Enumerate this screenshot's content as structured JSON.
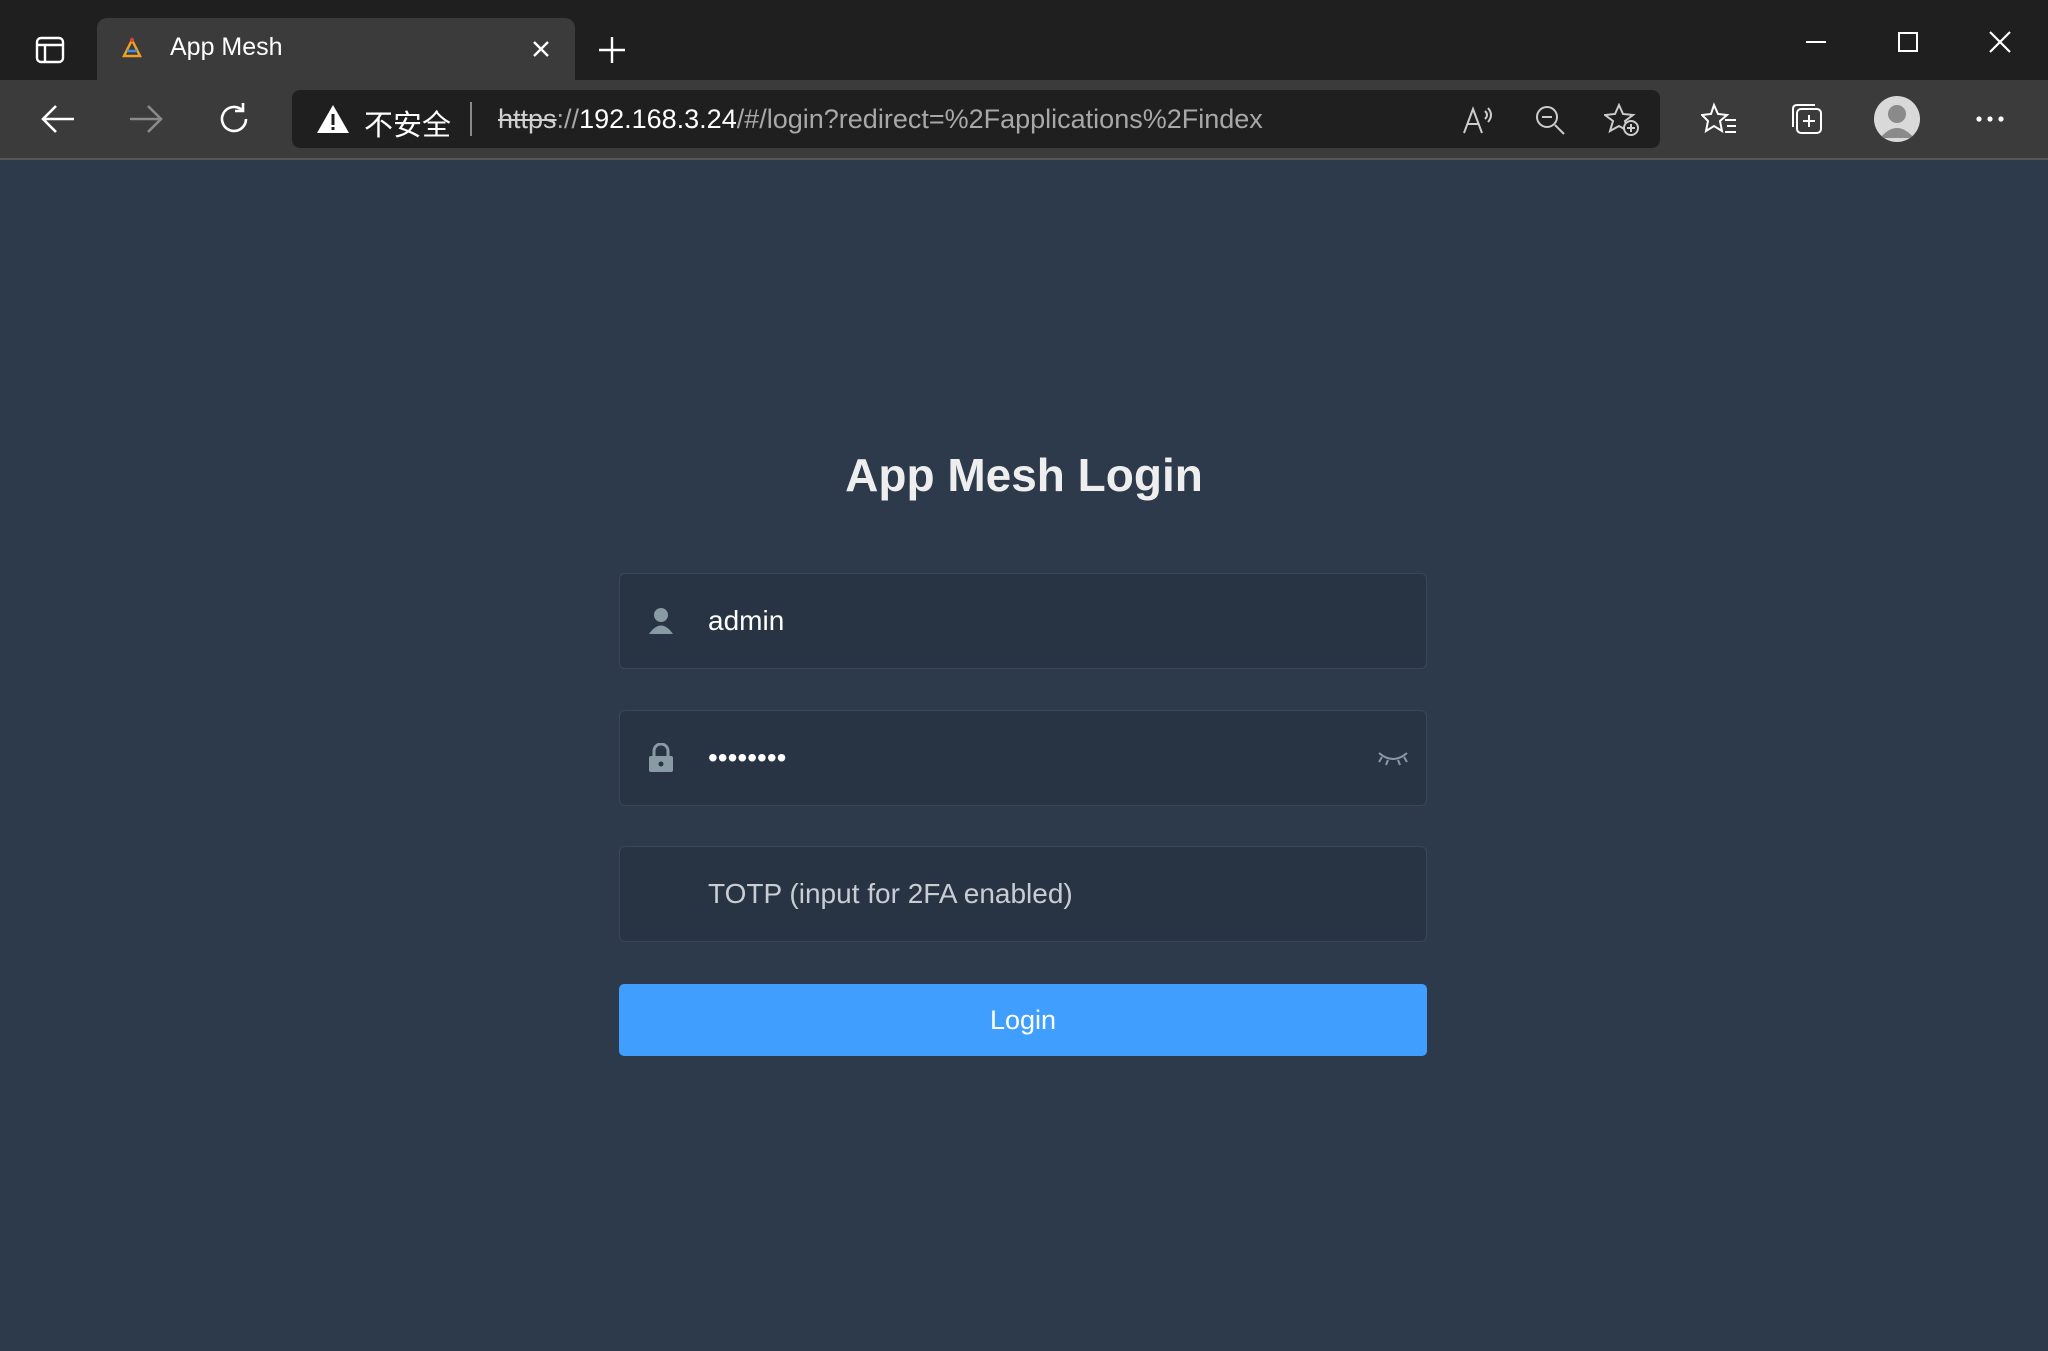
{
  "browser": {
    "tab": {
      "title": "App Mesh"
    },
    "address": {
      "security_label": "不安全",
      "url_scheme": "https",
      "url_separator": "://",
      "url_host": "192.168.3.24",
      "url_path": "/#/login?redirect=%2Fapplications%2Findex"
    },
    "icons": {
      "sidebar": "sidebar-toggle-icon",
      "close_tab": "close-icon",
      "new_tab": "plus-icon",
      "back": "back-arrow-icon",
      "forward": "forward-arrow-icon",
      "refresh": "refresh-icon",
      "read_aloud": "read-aloud-icon",
      "zoom": "zoom-out-icon",
      "add_favorite": "add-favorite-icon",
      "favorites": "favorites-icon",
      "collections": "collections-icon",
      "profile": "profile-avatar",
      "more": "more-icon"
    }
  },
  "login": {
    "title": "App Mesh Login",
    "username": {
      "value": "admin",
      "icon": "user-icon"
    },
    "password": {
      "value": "password",
      "icon": "lock-icon",
      "toggle_icon": "eye-closed-icon"
    },
    "totp": {
      "value": "",
      "placeholder": "TOTP (input for 2FA enabled)"
    },
    "button_label": "Login"
  },
  "colors": {
    "page_background": "#2d3a4b",
    "field_background": "#283443",
    "button": "#409eff",
    "chrome_dark": "#1f1f1f",
    "chrome_toolbar": "#3b3b3b"
  }
}
